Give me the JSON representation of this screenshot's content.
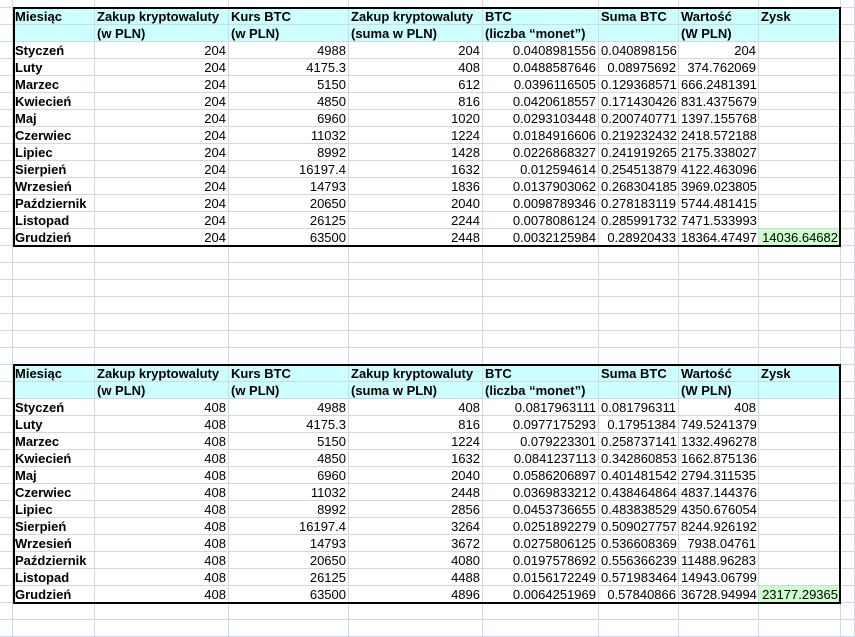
{
  "tables": [
    {
      "headers": [
        [
          "Miesiąc",
          ""
        ],
        [
          "Zakup kryptowaluty",
          "(w PLN)"
        ],
        [
          "Kurs BTC",
          "(w PLN)"
        ],
        [
          "Zakup kryptowaluty",
          "(suma w PLN)"
        ],
        [
          "BTC",
          "(liczba “monet”)"
        ],
        [
          "Suma BTC",
          ""
        ],
        [
          "Wartość",
          "(W PLN)"
        ],
        [
          "Zysk",
          ""
        ]
      ],
      "rows": [
        [
          "Styczeń",
          "204",
          "4988",
          "204",
          "0.0408981556",
          "0.040898156",
          "204",
          ""
        ],
        [
          "Luty",
          "204",
          "4175.3",
          "408",
          "0.0488587646",
          "0.08975692",
          "374.762069",
          ""
        ],
        [
          "Marzec",
          "204",
          "5150",
          "612",
          "0.0396116505",
          "0.129368571",
          "666.2481391",
          ""
        ],
        [
          "Kwiecień",
          "204",
          "4850",
          "816",
          "0.0420618557",
          "0.171430426",
          "831.4375679",
          ""
        ],
        [
          "Maj",
          "204",
          "6960",
          "1020",
          "0.0293103448",
          "0.200740771",
          "1397.155768",
          ""
        ],
        [
          "Czerwiec",
          "204",
          "11032",
          "1224",
          "0.0184916606",
          "0.219232432",
          "2418.572188",
          ""
        ],
        [
          "Lipiec",
          "204",
          "8992",
          "1428",
          "0.0226868327",
          "0.241919265",
          "2175.338027",
          ""
        ],
        [
          "Sierpień",
          "204",
          "16197.4",
          "1632",
          "0.012594614",
          "0.254513879",
          "4122.463096",
          ""
        ],
        [
          "Wrzesień",
          "204",
          "14793",
          "1836",
          "0.0137903062",
          "0.268304185",
          "3969.023805",
          ""
        ],
        [
          "Październik",
          "204",
          "20650",
          "2040",
          "0.0098789346",
          "0.278183119",
          "5744.481415",
          ""
        ],
        [
          "Listopad",
          "204",
          "26125",
          "2244",
          "0.0078086124",
          "0.285991732",
          "7471.533993",
          ""
        ],
        [
          "Grudzień",
          "204",
          "63500",
          "2448",
          "0.0032125984",
          "0.28920433",
          "18364.47497",
          "14036.64682"
        ]
      ]
    },
    {
      "headers": [
        [
          "Miesiąc",
          ""
        ],
        [
          "Zakup kryptowaluty",
          "(w PLN)"
        ],
        [
          "Kurs BTC",
          "(w PLN)"
        ],
        [
          "Zakup kryptowaluty",
          "(suma w PLN)"
        ],
        [
          "BTC",
          "(liczba “monet”)"
        ],
        [
          "Suma BTC",
          ""
        ],
        [
          "Wartość",
          "(W PLN)"
        ],
        [
          "Zysk",
          ""
        ]
      ],
      "rows": [
        [
          "Styczeń",
          "408",
          "4988",
          "408",
          "0.0817963111",
          "0.081796311",
          "408",
          ""
        ],
        [
          "Luty",
          "408",
          "4175.3",
          "816",
          "0.0977175293",
          "0.17951384",
          "749.5241379",
          ""
        ],
        [
          "Marzec",
          "408",
          "5150",
          "1224",
          "0.079223301",
          "0.258737141",
          "1332.496278",
          ""
        ],
        [
          "Kwiecień",
          "408",
          "4850",
          "1632",
          "0.0841237113",
          "0.342860853",
          "1662.875136",
          ""
        ],
        [
          "Maj",
          "408",
          "6960",
          "2040",
          "0.0586206897",
          "0.401481542",
          "2794.311535",
          ""
        ],
        [
          "Czerwiec",
          "408",
          "11032",
          "2448",
          "0.0369833212",
          "0.438464864",
          "4837.144376",
          ""
        ],
        [
          "Lipiec",
          "408",
          "8992",
          "2856",
          "0.0453736655",
          "0.483838529",
          "4350.676054",
          ""
        ],
        [
          "Sierpień",
          "408",
          "16197.4",
          "3264",
          "0.0251892279",
          "0.509027757",
          "8244.926192",
          ""
        ],
        [
          "Wrzesień",
          "408",
          "14793",
          "3672",
          "0.0275806125",
          "0.536608369",
          "7938.04761",
          ""
        ],
        [
          "Październik",
          "408",
          "20650",
          "4080",
          "0.0197578692",
          "0.556366239",
          "11488.96283",
          ""
        ],
        [
          "Listopad",
          "408",
          "26125",
          "4488",
          "0.0156172249",
          "0.571983464",
          "14943.06799",
          ""
        ],
        [
          "Grudzień",
          "408",
          "63500",
          "4896",
          "0.0064251969",
          "0.57840866",
          "36728.94994",
          "23177.29365"
        ]
      ]
    }
  ],
  "colors": {
    "header_fill": "#ccffff",
    "profit_fill": "#ccffcc",
    "gridline": "#d0d7e5",
    "table_border": "#000000"
  }
}
